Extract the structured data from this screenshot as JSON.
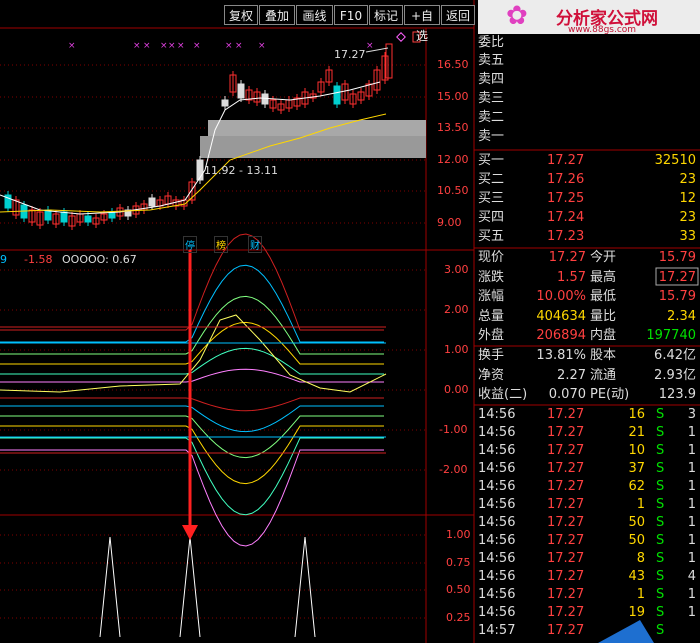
{
  "toolbar": [
    "复权",
    "叠加",
    "画线",
    "F10",
    "标记",
    "+自选",
    "返回"
  ],
  "logo": {
    "text": "分析家公式网",
    "url": "www.88gs.com"
  },
  "main_chart": {
    "yaxis": [
      "16.50",
      "15.00",
      "13.50",
      "12.00",
      "10.50",
      "9.00"
    ],
    "high_label": "17.27",
    "range_label": "11.92 - 13.11",
    "event_tags": [
      {
        "t": "停",
        "c": "#00c0ff"
      },
      {
        "t": "榜",
        "c": "#ffd700"
      },
      {
        "t": "财",
        "c": "#00c0ff"
      }
    ]
  },
  "indicator1": {
    "header": [
      "9",
      "-1.58",
      "OOOOO: 0.67"
    ],
    "yaxis": [
      "3.00",
      "2.00",
      "1.00",
      "0.00",
      "-1.00",
      "-2.00"
    ]
  },
  "indicator2": {
    "yaxis": [
      "1.00",
      "0.75",
      "0.50",
      "0.25"
    ]
  },
  "orderbook": {
    "title": "委比",
    "asks": [
      "卖五",
      "卖四",
      "卖三",
      "卖二",
      "卖一"
    ],
    "bids": [
      {
        "label": "买一",
        "price": "17.27",
        "vol": "32510"
      },
      {
        "label": "买二",
        "price": "17.26",
        "vol": "23"
      },
      {
        "label": "买三",
        "price": "17.25",
        "vol": "12"
      },
      {
        "label": "买四",
        "price": "17.24",
        "vol": "23"
      },
      {
        "label": "买五",
        "price": "17.23",
        "vol": "33"
      }
    ]
  },
  "stats": [
    {
      "l1": "现价",
      "v1": "17.27",
      "c1": "rd",
      "l2": "今开",
      "v2": "15.79",
      "c2": "rd"
    },
    {
      "l1": "涨跌",
      "v1": "1.57",
      "c1": "rd",
      "l2": "最高",
      "v2": "17.27",
      "c2": "rd"
    },
    {
      "l1": "涨幅",
      "v1": "10.00%",
      "c1": "rd",
      "l2": "最低",
      "v2": "15.79",
      "c2": "rd"
    },
    {
      "l1": "总量",
      "v1": "404634",
      "c1": "ye",
      "l2": "量比",
      "v2": "2.34",
      "c2": "ye"
    },
    {
      "l1": "外盘",
      "v1": "206894",
      "c1": "rd",
      "l2": "内盘",
      "v2": "197740",
      "c2": "gr"
    },
    {
      "l1": "换手",
      "v1": "13.81%",
      "c1": "wh",
      "l2": "股本",
      "v2": "6.42亿",
      "c2": "wh"
    },
    {
      "l1": "净资",
      "v1": "2.27",
      "c1": "wh",
      "l2": "流通",
      "v2": "2.93亿",
      "c2": "wh"
    },
    {
      "l1": "收益(二)",
      "v1": "0.070",
      "c1": "wh",
      "l2": "PE(动)",
      "v2": "123.9",
      "c2": "wh"
    }
  ],
  "trades": [
    {
      "t": "14:56",
      "p": "17.27",
      "v": "16",
      "s": "S",
      "n": "3"
    },
    {
      "t": "14:56",
      "p": "17.27",
      "v": "21",
      "s": "S",
      "n": "1"
    },
    {
      "t": "14:56",
      "p": "17.27",
      "v": "10",
      "s": "S",
      "n": "1"
    },
    {
      "t": "14:56",
      "p": "17.27",
      "v": "37",
      "s": "S",
      "n": "1"
    },
    {
      "t": "14:56",
      "p": "17.27",
      "v": "62",
      "s": "S",
      "n": "1"
    },
    {
      "t": "14:56",
      "p": "17.27",
      "v": "1",
      "s": "S",
      "n": "1"
    },
    {
      "t": "14:56",
      "p": "17.27",
      "v": "50",
      "s": "S",
      "n": "1"
    },
    {
      "t": "14:56",
      "p": "17.27",
      "v": "50",
      "s": "S",
      "n": "1"
    },
    {
      "t": "14:56",
      "p": "17.27",
      "v": "8",
      "s": "S",
      "n": "1"
    },
    {
      "t": "14:56",
      "p": "17.27",
      "v": "43",
      "s": "S",
      "n": "4"
    },
    {
      "t": "14:56",
      "p": "17.27",
      "v": "1",
      "s": "S",
      "n": "1"
    },
    {
      "t": "14:56",
      "p": "17.27",
      "v": "19",
      "s": "S",
      "n": "1"
    },
    {
      "t": "14:57",
      "p": "17.27",
      "v": "",
      "s": "S",
      "n": ""
    }
  ]
}
